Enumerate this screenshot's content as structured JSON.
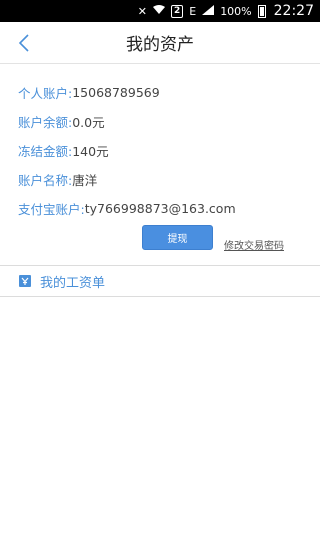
{
  "status_bar": {
    "signal_glyph": "🔇",
    "badge": "2",
    "network": "E",
    "battery": "100%",
    "time": "22:27"
  },
  "header": {
    "title": "我的资产",
    "back_icon": "chevron-left-icon"
  },
  "account": {
    "rows": [
      {
        "label": "个人账户:",
        "value": " 15068789569"
      },
      {
        "label": "账户余额:",
        "value": " 0.0元"
      },
      {
        "label": "冻结金额:",
        "value": " 140元"
      },
      {
        "label": "账户名称:",
        "value": " 唐洋"
      },
      {
        "label": "支付宝账户:",
        "value": " ty766998873@163.com"
      }
    ],
    "withdraw_label": "提现",
    "change_password_label": "修改交易密码"
  },
  "payslip": {
    "label": "我的工资单",
    "icon": "payslip-icon"
  },
  "colors": {
    "accent": "#4a90d9",
    "button": "#4a8fe0"
  }
}
